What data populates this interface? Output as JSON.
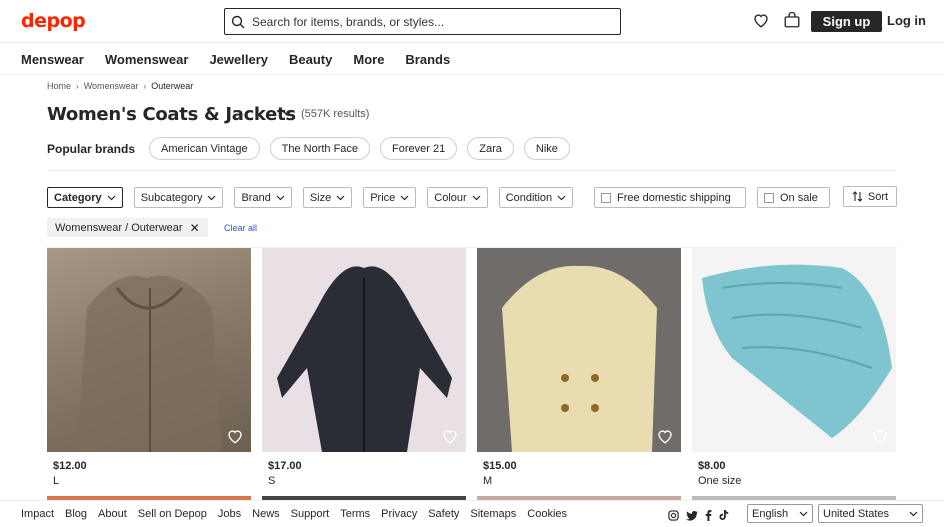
{
  "header": {
    "logo": "depop",
    "search_placeholder": "Search for items, brands, or styles...",
    "signup_label": "Sign up",
    "login_label": "Log in"
  },
  "nav": {
    "categories": [
      "Menswear",
      "Womenswear",
      "Jewellery",
      "Beauty",
      "More",
      "Brands"
    ]
  },
  "breadcrumb": {
    "items": [
      "Home",
      "Womenswear",
      "Outerwear"
    ]
  },
  "page": {
    "title": "Women's Coats & Jackets",
    "results": "(557K results)",
    "popular_label": "Popular brands",
    "brands": [
      "American Vintage",
      "The North Face",
      "Forever 21",
      "Zara",
      "Nike"
    ]
  },
  "filters": {
    "items": [
      "Category",
      "Subcategory",
      "Brand",
      "Size",
      "Price",
      "Colour",
      "Condition"
    ],
    "free_shipping": "Free domestic shipping",
    "on_sale": "On sale",
    "sort": "Sort",
    "selected": "Womenswear / Outerwear",
    "clear_all": "Clear all"
  },
  "products": [
    {
      "price": "$12.00",
      "size": "L",
      "color": "#8a7a68"
    },
    {
      "price": "$17.00",
      "size": "S",
      "color": "#2a2d36"
    },
    {
      "price": "$15.00",
      "size": "M",
      "color": "#e8dcb0"
    },
    {
      "price": "$8.00",
      "size": "One size",
      "color": "#7fc5d0"
    }
  ],
  "footer": {
    "links": [
      "Impact",
      "Blog",
      "About",
      "Sell on Depop",
      "Jobs",
      "News",
      "Support",
      "Terms",
      "Privacy",
      "Safety",
      "Sitemaps",
      "Cookies"
    ],
    "social_icons": [
      "instagram-icon",
      "twitter-icon",
      "facebook-icon",
      "tiktok-icon"
    ],
    "language": "English",
    "country": "United States"
  },
  "colors": {
    "brand_red": "#ff2300",
    "text": "#262626",
    "link_blue": "#2a5ad8"
  }
}
